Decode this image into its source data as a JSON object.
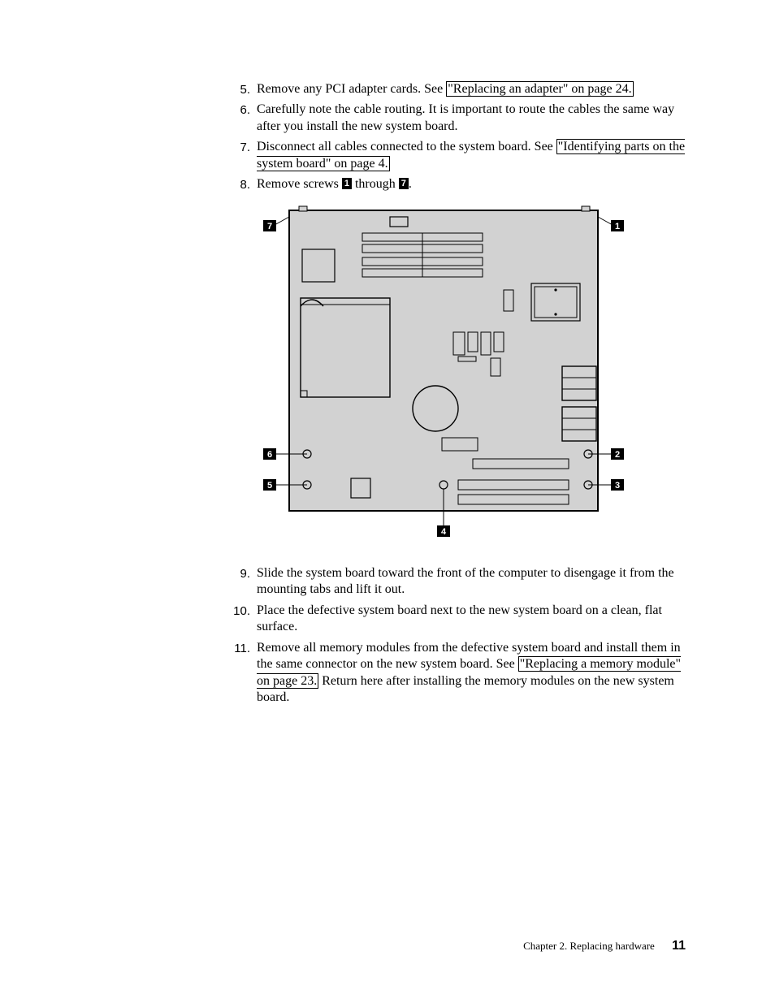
{
  "items": [
    {
      "num": "5.",
      "pre": "Remove any PCI adapter cards. See ",
      "link": "\"Replacing an adapter\" on page 24.",
      "post": ""
    },
    {
      "num": "6.",
      "pre": "Carefully note the cable routing. It is important to route the cables the same way after you install the new system board.",
      "link": "",
      "post": ""
    },
    {
      "num": "7.",
      "pre": "Disconnect all cables connected to the system board. See ",
      "link": "\"Identifying parts on the system board\" on page 4.",
      "post": ""
    },
    {
      "num": "8.",
      "pre": "Remove screws ",
      "mid": " through ",
      "post": ".",
      "badgeA": "1",
      "badgeB": "7"
    }
  ],
  "itemsAfter": [
    {
      "num": "9.",
      "pre": "Slide the system board toward the front of the computer to disengage it from the mounting tabs and lift it out.",
      "link": "",
      "post": ""
    },
    {
      "num": "10.",
      "pre": "Place the defective system board next to the new system board on a clean, flat surface.",
      "link": "",
      "post": ""
    },
    {
      "num": "11.",
      "pre": "Remove all memory modules from the defective system board and install them in the same connector on the new system board. See ",
      "link": "\"Replacing a memory module\" on page 23.",
      "post": " Return here after installing the memory modules on the new system board."
    }
  ],
  "diagram": {
    "labels": [
      "1",
      "2",
      "3",
      "4",
      "5",
      "6",
      "7"
    ]
  },
  "footer": {
    "chapter": "Chapter 2. Replacing hardware",
    "page": "11"
  }
}
